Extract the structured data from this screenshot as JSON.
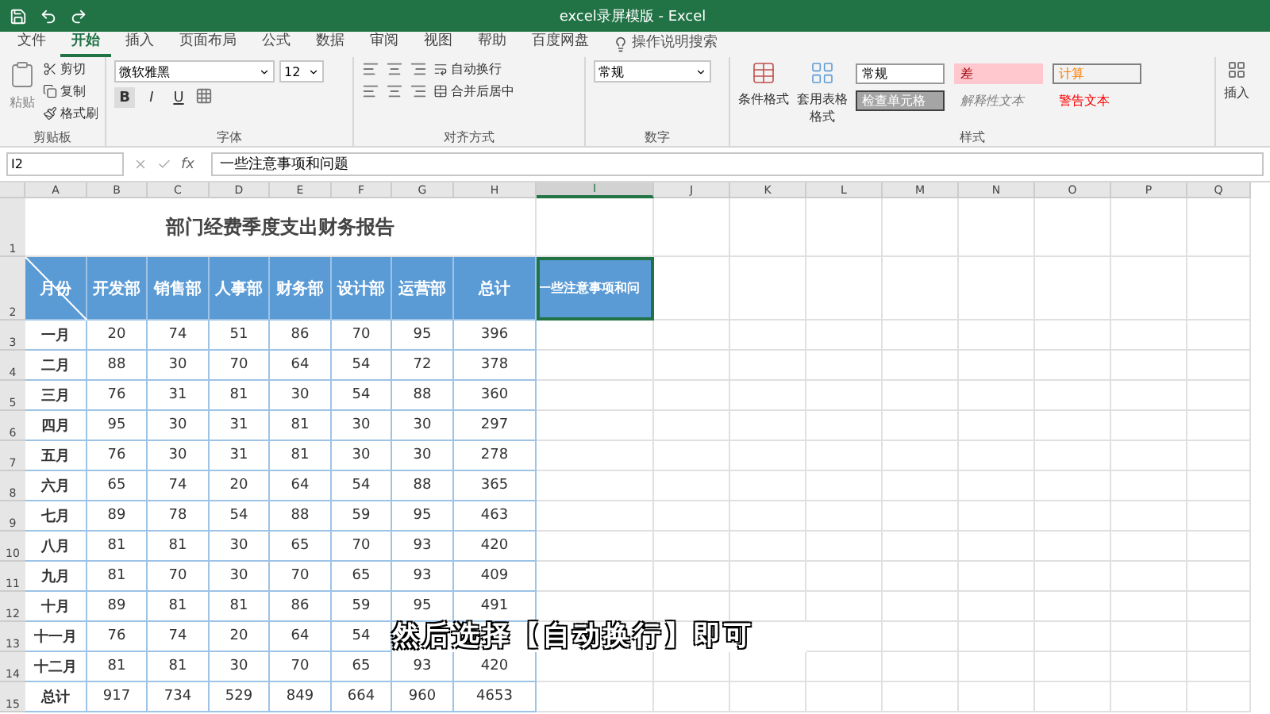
{
  "window": {
    "title": "excel录屏模版 - Excel"
  },
  "ribbon_tabs": [
    {
      "label": "文件",
      "selected": false
    },
    {
      "label": "开始",
      "selected": true
    },
    {
      "label": "插入",
      "selected": false
    },
    {
      "label": "页面布局",
      "selected": false
    },
    {
      "label": "公式",
      "selected": false
    },
    {
      "label": "数据",
      "selected": false
    },
    {
      "label": "审阅",
      "selected": false
    },
    {
      "label": "视图",
      "selected": false
    },
    {
      "label": "帮助",
      "selected": false
    },
    {
      "label": "百度网盘",
      "selected": false
    }
  ],
  "tell_me": "操作说明搜索",
  "clipboard": {
    "label": "剪贴板",
    "paste": "粘贴",
    "items": [
      "剪切",
      "复制",
      "格式刷"
    ]
  },
  "font": {
    "label": "字体",
    "font_name": "微软雅黑",
    "font_size": "12",
    "buttons": [
      {
        "label": "B",
        "kind": "bold"
      },
      {
        "label": "I",
        "kind": "italic"
      },
      {
        "label": "U",
        "kind": "underline"
      }
    ]
  },
  "alignment": {
    "label": "对齐方式",
    "wrap_text": "自动换行",
    "merge": "合并后居中"
  },
  "number": {
    "label": "数字",
    "format": "常规"
  },
  "styles": {
    "label": "样式",
    "conditional": "条件格式",
    "table_format": "套用表格格式",
    "cell_styles": [
      {
        "label": "常规",
        "kind": "normal"
      },
      {
        "label": "差",
        "kind": "bad"
      },
      {
        "label": "计算",
        "kind": "calc"
      },
      {
        "label": "检查单元格",
        "kind": "check"
      },
      {
        "label": "解释性文本",
        "kind": "explain"
      },
      {
        "label": "警告文本",
        "kind": "warn"
      }
    ]
  },
  "cells": {
    "insert": "插入"
  },
  "formula_bar": {
    "name_box": "I2",
    "fx": "fx",
    "formula": "一些注意事项和问题"
  },
  "columns": [
    {
      "label": "A",
      "selected": false
    },
    {
      "label": "B",
      "selected": false
    },
    {
      "label": "C",
      "selected": false
    },
    {
      "label": "D",
      "selected": false
    },
    {
      "label": "E",
      "selected": false
    },
    {
      "label": "F",
      "selected": false
    },
    {
      "label": "G",
      "selected": false
    },
    {
      "label": "H",
      "selected": false
    },
    {
      "label": "I",
      "selected": true
    },
    {
      "label": "J",
      "selected": false
    },
    {
      "label": "K",
      "selected": false
    },
    {
      "label": "L",
      "selected": false
    },
    {
      "label": "M",
      "selected": false
    },
    {
      "label": "N",
      "selected": false
    },
    {
      "label": "O",
      "selected": false
    },
    {
      "label": "P",
      "selected": false
    },
    {
      "label": "Q",
      "selected": false
    }
  ],
  "row_numbers": [
    "1",
    "2",
    "3",
    "4",
    "5",
    "6",
    "7",
    "8",
    "9",
    "10",
    "11",
    "12",
    "13",
    "14",
    "15"
  ],
  "report_title": "部门经费季度支出财务报告",
  "header_cells": [
    {
      "text": "月份",
      "selected": false
    },
    {
      "text": "开发部",
      "selected": false
    },
    {
      "text": "销售部",
      "selected": false
    },
    {
      "text": "人事部",
      "selected": false
    },
    {
      "text": "财务部",
      "selected": false
    },
    {
      "text": "设计部",
      "selected": false
    },
    {
      "text": "运营部",
      "selected": false
    },
    {
      "text": "总计",
      "selected": false
    },
    {
      "text": "一些注意事项和问",
      "selected": true
    }
  ],
  "rows": [
    {
      "month": "一月",
      "values": [
        "20",
        "74",
        "51",
        "86",
        "70",
        "95",
        "396"
      ]
    },
    {
      "month": "二月",
      "values": [
        "88",
        "30",
        "70",
        "64",
        "54",
        "72",
        "378"
      ]
    },
    {
      "month": "三月",
      "values": [
        "76",
        "31",
        "81",
        "30",
        "54",
        "88",
        "360"
      ]
    },
    {
      "month": "四月",
      "values": [
        "95",
        "30",
        "31",
        "81",
        "30",
        "30",
        "297"
      ]
    },
    {
      "month": "五月",
      "values": [
        "76",
        "30",
        "31",
        "81",
        "30",
        "30",
        "278"
      ]
    },
    {
      "month": "六月",
      "values": [
        "65",
        "74",
        "20",
        "64",
        "54",
        "88",
        "365"
      ]
    },
    {
      "month": "七月",
      "values": [
        "89",
        "78",
        "54",
        "88",
        "59",
        "95",
        "463"
      ]
    },
    {
      "month": "八月",
      "values": [
        "81",
        "81",
        "30",
        "65",
        "70",
        "93",
        "420"
      ]
    },
    {
      "month": "九月",
      "values": [
        "81",
        "70",
        "30",
        "70",
        "65",
        "93",
        "409"
      ]
    },
    {
      "month": "十月",
      "values": [
        "89",
        "81",
        "81",
        "86",
        "59",
        "95",
        "491"
      ]
    },
    {
      "month": "十一月",
      "values": [
        "76",
        "74",
        "20",
        "64",
        "54"
      ]
    },
    {
      "month": "十二月",
      "values": [
        "81",
        "81",
        "30",
        "70",
        "65",
        "93",
        "420"
      ]
    },
    {
      "month": "总计",
      "values": [
        "917",
        "734",
        "529",
        "849",
        "664",
        "960",
        "4653"
      ]
    }
  ],
  "caption": "然后选择【自动换行】即可"
}
